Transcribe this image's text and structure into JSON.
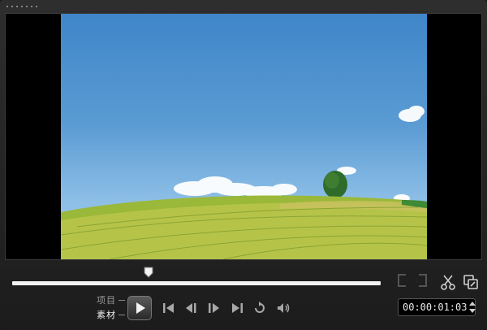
{
  "modes": {
    "project": "项目",
    "clip": "素材",
    "active": "clip"
  },
  "playback": {
    "position": 0.37,
    "timecode": "00:00:01:03"
  },
  "icons": {
    "play": "play-icon",
    "home": "go-to-start-icon",
    "prev": "previous-frame-icon",
    "next": "next-frame-icon",
    "end": "go-to-end-icon",
    "repeat": "repeat-icon",
    "volume": "volume-icon",
    "mark_in": "mark-in-icon",
    "mark_out": "mark-out-icon",
    "cut": "scissors-icon",
    "copy": "enlarge-icon"
  },
  "colors": {
    "background": "#1c1c1c",
    "control_icon": "#a8a8a8",
    "track": "#f2f2f2"
  }
}
